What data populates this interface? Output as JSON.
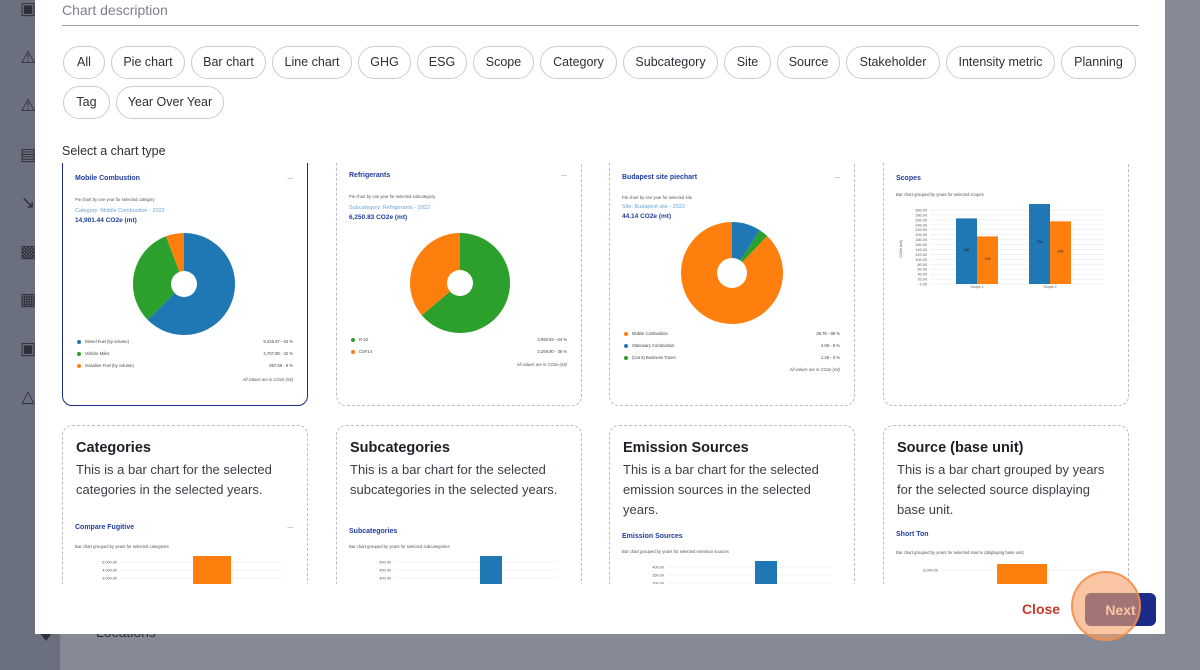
{
  "background": {
    "locations_label": "Locations",
    "sidebar_icons": [
      "chat-icon",
      "alert-icon",
      "alert-icon",
      "list-icon",
      "trend-icon",
      "truck-icon",
      "clipboard-icon",
      "chat-icon",
      "shapes-icon"
    ]
  },
  "modal": {
    "description_label": "Chart description",
    "select_label": "Select a chart type",
    "filters": [
      "All",
      "Pie chart",
      "Bar chart",
      "Line chart",
      "GHG",
      "ESG",
      "Scope",
      "Category",
      "Subcategory",
      "Site",
      "Source",
      "Stakeholder",
      "Intensity metric",
      "Planning",
      "Tag",
      "Year Over Year"
    ],
    "close_label": "Close",
    "next_label": "Next"
  },
  "cards": [
    {
      "preview_title": "Mobile Combustion",
      "menu": "...",
      "subtitle": "Pie chart by one year for selected category",
      "category_line": "Category: Mobile Combustion - 2022",
      "total": "14,901.44 CO2e (mt)",
      "legend": [
        {
          "name": "Diesel Fuel (by volume)",
          "value": "9,335.97 - 63 %",
          "color": "#1f77b4"
        },
        {
          "name": "Vehicle Miles",
          "value": "4,707.88 - 32 %",
          "color": "#2ca02c"
        },
        {
          "name": "Gasoline Fuel (by volume)",
          "value": "857.59 - 6 %",
          "color": "#ff7f0e"
        }
      ],
      "footnote": "All values are in CO2e (mt)",
      "selected": true
    },
    {
      "preview_title": "Refrigerants",
      "menu": "...",
      "subtitle": "Pie chart by one year for selected subcategory",
      "category_line": "Subcategory: Refrigerants - 2022",
      "total": "6,250.83 CO2e (mt)",
      "legend": [
        {
          "name": "R-22",
          "value": "3,990.93 - 64 %",
          "color": "#2ca02c"
        },
        {
          "name": "CSF14",
          "value": "2,259.90 - 36 %",
          "color": "#ff7f0e"
        }
      ],
      "footnote": "All values are in CO2e (mt)",
      "selected": false
    },
    {
      "preview_title": "Budapest site piechart",
      "menu": "...",
      "subtitle": "Pie chart by one year for selected site",
      "category_line": "Site: Budapest site - 2022",
      "total": "44.14 CO2e (mt)",
      "legend": [
        {
          "name": "Mobile Combustion",
          "value": "38.76 - 88 %",
          "color": "#ff7f0e"
        },
        {
          "name": "Stationary Combustion",
          "value": "4.06 - 9 %",
          "color": "#1f77b4"
        },
        {
          "name": "(Cat 6) Business Travel",
          "value": "1.28 - 3 %",
          "color": "#2ca02c"
        }
      ],
      "footnote": "All values are in CO2e (mt)",
      "selected": false
    },
    {
      "preview_title": "Scopes",
      "subtitle": "Bar chart grouped by years for selected scopes",
      "ylabel": "CO2e (mt)",
      "yticks": [
        "300.00",
        "280.00",
        "260.00",
        "240.00",
        "220.00",
        "200.00",
        "180.00",
        "160.00",
        "140.00",
        "120.00",
        "100.00",
        "80.00",
        "60.00",
        "40.00",
        "20.00",
        "0.00"
      ],
      "groups": [
        "Scope 1",
        "Scope 2"
      ],
      "series": [
        {
          "color": "#1f77b4",
          "values": [
            266,
            334
          ],
          "labels": [
            "266",
            "334"
          ]
        },
        {
          "color": "#ff7f0e",
          "values": [
            193,
            254
          ],
          "labels": [
            "193",
            "254"
          ]
        }
      ],
      "selected": false
    }
  ],
  "bottom_cards": [
    {
      "heading": "Categories",
      "description": "This is a bar chart for the selected categories in the selected years.",
      "preview_title": "Compare Fugitive",
      "menu": "...",
      "preview_subtitle": "Bar chart grouped by years for selected categories",
      "yticks": [
        "5,000.00",
        "4,000.00",
        "3,000.00"
      ],
      "bar_color": "#ff7f0e"
    },
    {
      "heading": "Subcategories",
      "description": "This is a bar chart for the selected subcategories in the selected years.",
      "preview_title": "Subcategories",
      "menu": "",
      "preview_subtitle": "Bar chart grouped by years for selected subcategories",
      "yticks": [
        "500.00",
        "450.00",
        "400.00",
        "350.00"
      ],
      "bar_color": "#1f77b4"
    },
    {
      "heading": "Emission Sources",
      "description": "This is a bar chart for the selected emission sources in the selected years.",
      "preview_title": "Emission Sources",
      "menu": "",
      "preview_subtitle": "Bar chart grouped by years for selected emission sources",
      "yticks": [
        "400.00",
        "350.00",
        "300.00"
      ],
      "bar_color": "#1f77b4"
    },
    {
      "heading": "Source (base unit)",
      "description": "This is a bar chart grouped by years for the selected source displaying base unit.",
      "preview_title": "Short Ton",
      "menu": "",
      "preview_subtitle": "Bar chart grouped by years for selected source (displaying base unit)",
      "yticks": [
        "8,000.00"
      ],
      "bar_color": "#ff7f0e"
    }
  ]
}
